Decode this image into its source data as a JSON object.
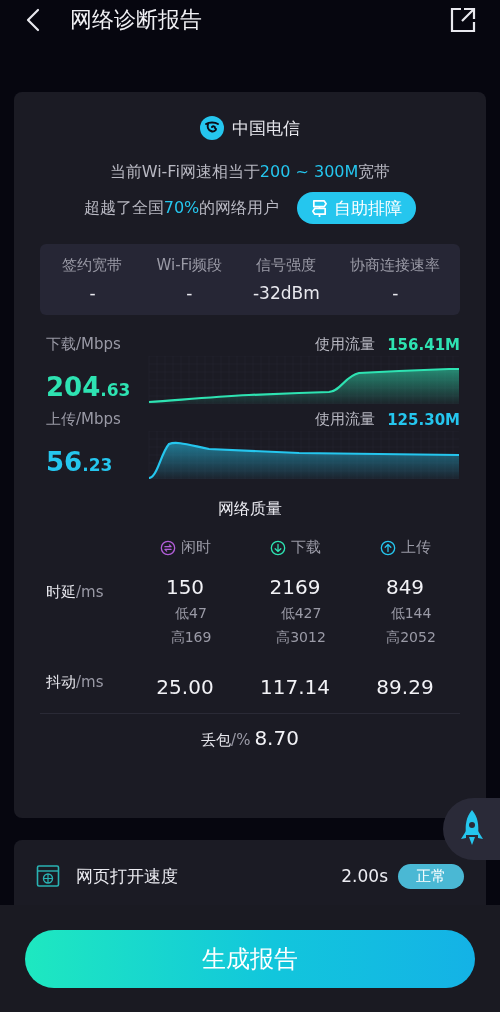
{
  "header": {
    "title": "网络诊断报告"
  },
  "summary": {
    "carrier": "中国电信",
    "speed_line": [
      {
        "text": "当前Wi-Fi网速相当于",
        "highlight": false
      },
      {
        "text": "200 ~ 300M",
        "highlight": true
      },
      {
        "text": "宽带",
        "highlight": false
      }
    ],
    "rank_line": [
      {
        "text": "超越了全国",
        "highlight": false
      },
      {
        "text": "70%",
        "highlight": true
      },
      {
        "text": "的网络用户",
        "highlight": false
      }
    ],
    "action_button": "自助排障"
  },
  "info": [
    {
      "label": "签约宽带",
      "value": "-"
    },
    {
      "label": "Wi-Fi频段",
      "value": "-"
    },
    {
      "label": "信号强度",
      "value": "-32dBm"
    },
    {
      "label": "协商连接速率",
      "value": "-"
    }
  ],
  "throughput": [
    {
      "kind": "download",
      "label": "下载/Mbps",
      "value": "204.63",
      "usage_label": "使用流量",
      "usage": "156.41M"
    },
    {
      "kind": "upload",
      "label": "上传/Mbps",
      "value": "56.23",
      "usage_label": "使用流量",
      "usage": "125.30M"
    }
  ],
  "quality": {
    "title": "网络质量",
    "columns": [
      {
        "kind": "idle",
        "label": "闲时"
      },
      {
        "kind": "download",
        "label": "下载"
      },
      {
        "kind": "upload",
        "label": "上传"
      }
    ],
    "latency": {
      "label": "时延",
      "unit": "/ms",
      "values": [
        {
          "avg": "150",
          "low": "低47",
          "high": "高169"
        },
        {
          "avg": "2169",
          "low": "低427",
          "high": "高3012"
        },
        {
          "avg": "849",
          "low": "低144",
          "high": "高2052"
        }
      ]
    },
    "jitter": {
      "label": "抖动",
      "unit": "/ms",
      "values": [
        "25.00",
        "117.14",
        "89.29"
      ]
    },
    "loss": {
      "label": "丢包",
      "unit": "/%",
      "value": "8.70"
    }
  },
  "web_speed": {
    "label": "网页打开速度",
    "value": "2.00s",
    "status": "正常"
  },
  "generate_button": "生成报告"
}
